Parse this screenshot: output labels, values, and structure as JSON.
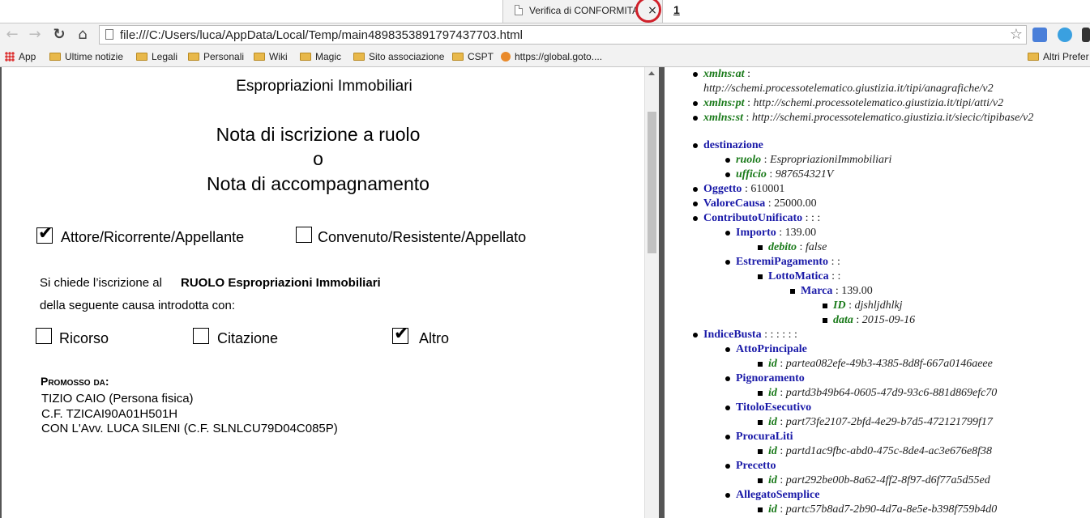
{
  "tab": {
    "title": "Verifica di CONFORMITA",
    "close": "×",
    "marker": "1"
  },
  "toolbar": {
    "back": "←",
    "forward": "→",
    "reload": "↻",
    "home": "⌂",
    "url": "file:///C:/Users/luca/AppData/Local/Temp/main4898353891797437703.html",
    "star": "☆"
  },
  "bookmarks": {
    "items": [
      "App",
      "Ultime notizie",
      "Legali",
      "Personali",
      "Wiki",
      "Magic",
      "Sito associazione",
      "CSPT",
      "https://global.goto...."
    ],
    "other": "Altri Prefer"
  },
  "document": {
    "header": "Espropriazioni Immobiliari",
    "title_line1": "Nota di iscrizione a ruolo",
    "title_line2": "o",
    "title_line3": "Nota di accompagnamento",
    "party_attore": "Attore/Ricorrente/Appellante",
    "party_convenuto": "Convenuto/Resistente/Appellato",
    "request_prefix": "Si chiede l’iscrizione al",
    "request_ruolo": "RUOLO Espropriazioni Immobiliari",
    "request_line2": "della seguente causa introdotta con:",
    "opt_ricorso": "Ricorso",
    "opt_citazione": "Citazione",
    "opt_altro": "Altro",
    "checkmark": "✔",
    "promosso_label": "Promosso da:",
    "promosso_1": "TIZIO CAIO (Persona fisica)",
    "promosso_2": "C.F. TZICAI90A01H501H",
    "promosso_3": "CON L'Avv. LUCA SILENI (C.F. SLNLCU79D04C085P)"
  },
  "xml": {
    "xmlns_at_k": "xmlns:at",
    "xmlns_at_v": "http://schemi.processotelematico.giustizia.it/tipi/anagrafiche/v2",
    "xmlns_pt_k": "xmlns:pt",
    "xmlns_pt_v": "http://schemi.processotelematico.giustizia.it/tipi/atti/v2",
    "xmlns_st_k": "xmlns:st",
    "xmlns_st_v": "http://schemi.processotelematico.giustizia.it/siecic/tipibase/v2",
    "destinazione": "destinazione",
    "ruolo_k": "ruolo",
    "ruolo_v": "EspropriazioniImmobiliari",
    "ufficio_k": "ufficio",
    "ufficio_v": "987654321V",
    "oggetto_k": "Oggetto",
    "oggetto_v": "610001",
    "valore_k": "ValoreCausa",
    "valore_v": "25000.00",
    "contributo_k": "ContributoUnificato",
    "contributo_v": ": : :",
    "importo_k": "Importo",
    "importo_v": "139.00",
    "debito_k": "debito",
    "debito_v": "false",
    "estremi_k": "EstremiPagamento",
    "estremi_v": ": :",
    "lotto_k": "LottoMatica",
    "lotto_v": ": :",
    "marca_k": "Marca",
    "marca_v": "139.00",
    "id_k": "ID",
    "id_v": "djshljdhlkj",
    "data_k": "data",
    "data_v": "2015-09-16",
    "indice_k": "IndiceBusta",
    "indice_v": ": : : : : :",
    "atto_k": "AttoPrincipale",
    "atto_id": "partea082efe-49b3-4385-8d8f-667a0146aeee",
    "pign_k": "Pignoramento",
    "pign_id": "partd3b49b64-0605-47d9-93c6-881d869efc70",
    "titolo_k": "TitoloEsecutivo",
    "titolo_id": "part73fe2107-2bfd-4e29-b7d5-472121799f17",
    "procura_k": "ProcuraLiti",
    "procura_id": "partd1ac9fbc-abd0-475c-8de4-ac3e676e8f38",
    "precetto_k": "Precetto",
    "precetto_id": "part292be00b-8a62-4ff2-8f97-d6f77a5d55ed",
    "allegato_k": "AllegatoSemplice",
    "allegato_id": "partc57b8ad7-2b90-4d7a-8e5e-b398f759b4d0",
    "id_key": "id",
    "sep": " : "
  }
}
